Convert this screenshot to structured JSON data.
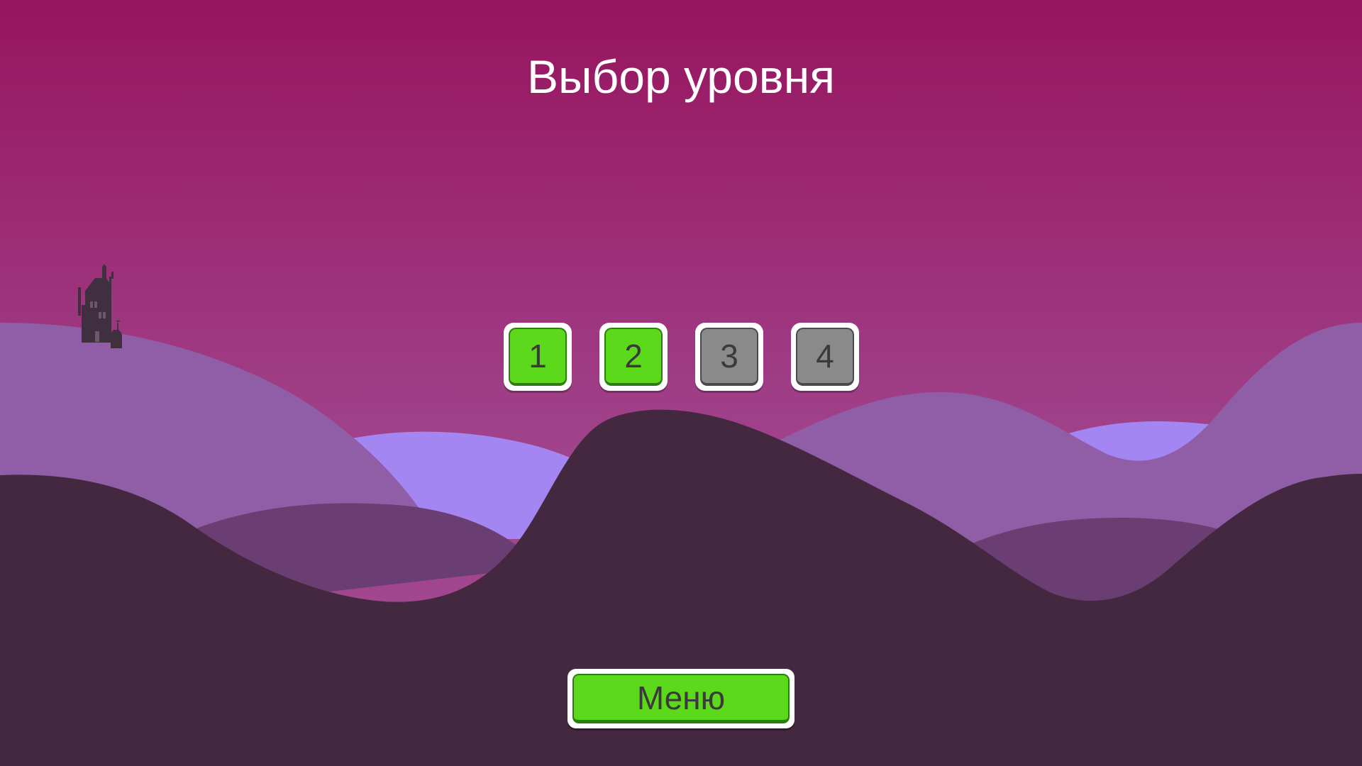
{
  "screen": {
    "title": "Выбор уровня"
  },
  "levels": [
    {
      "label": "1",
      "state": "unlocked"
    },
    {
      "label": "2",
      "state": "unlocked"
    },
    {
      "label": "3",
      "state": "locked"
    },
    {
      "label": "4",
      "state": "locked"
    }
  ],
  "menu_button": {
    "label": "Меню"
  },
  "colors": {
    "sky_top": "#97155e",
    "sky_bottom": "#a0448c",
    "hill_back_light": "#a486f2",
    "hill_mid": "#8f5ea7",
    "hill_mid_dark": "#6a3e72",
    "hill_front": "#442840",
    "castle": "#40303f",
    "unlocked": "#5dd91c",
    "locked": "#8a8a8a"
  },
  "decorations": {
    "castle_icon": "castle-icon"
  }
}
